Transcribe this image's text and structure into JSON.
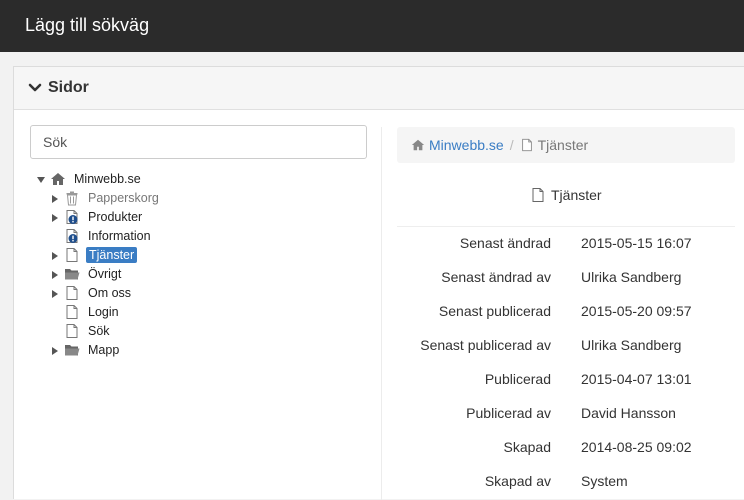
{
  "header": {
    "title": "Lägg till sökväg"
  },
  "panel": {
    "title": "Sidor"
  },
  "search": {
    "placeholder": "Sök"
  },
  "tree": {
    "root": {
      "label": "Minwebb.se",
      "icon": "home-icon",
      "expanded": true
    },
    "children": [
      {
        "label": "Papperskorg",
        "icon": "trash-icon",
        "has_children": true,
        "muted": true
      },
      {
        "label": "Produkter",
        "icon": "page-alert-icon",
        "has_children": true
      },
      {
        "label": "Information",
        "icon": "page-alert-icon",
        "has_children": false
      },
      {
        "label": "Tjänster",
        "icon": "page-icon",
        "has_children": true,
        "selected": true
      },
      {
        "label": "Övrigt",
        "icon": "folder-icon",
        "has_children": true
      },
      {
        "label": "Om oss",
        "icon": "page-icon",
        "has_children": true
      },
      {
        "label": "Login",
        "icon": "page-icon",
        "has_children": false
      },
      {
        "label": "Sök",
        "icon": "page-icon",
        "has_children": false
      },
      {
        "label": "Mapp",
        "icon": "folder-icon",
        "has_children": true
      }
    ]
  },
  "breadcrumb": {
    "root": "Minwebb.se",
    "separator": "/",
    "current": "Tjänster"
  },
  "detail": {
    "title": "Tjänster",
    "rows": [
      {
        "key": "Senast ändrad",
        "value": "2015-05-15 16:07"
      },
      {
        "key": "Senast ändrad av",
        "value": "Ulrika Sandberg"
      },
      {
        "key": "Senast publicerad",
        "value": "2015-05-20 09:57"
      },
      {
        "key": "Senast publicerad av",
        "value": "Ulrika Sandberg"
      },
      {
        "key": "Publicerad",
        "value": "2015-04-07 13:01"
      },
      {
        "key": "Publicerad av",
        "value": "David Hansson"
      },
      {
        "key": "Skapad",
        "value": "2014-08-25 09:02"
      },
      {
        "key": "Skapad av",
        "value": "System"
      }
    ]
  },
  "colors": {
    "topbar": "#2b2b2b",
    "accent": "#3a7dc4",
    "alert": "#1f4e8c"
  }
}
